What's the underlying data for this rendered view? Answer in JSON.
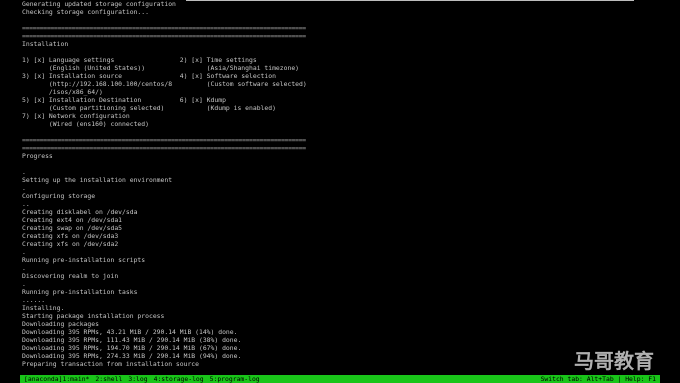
{
  "console": {
    "lines": [
      "Generating updated storage configuration",
      "Checking storage configuration...",
      "",
      "================================================================================",
      "================================================================================",
      "Installation",
      "",
      "1) [x] Language settings                 2) [x] Time settings",
      "       (English (United States))                (Asia/Shanghai timezone)",
      "3) [x] Installation source               4) [x] Software selection",
      "       (http://192.168.100.100/centos/8         (Custom software selected)",
      "       /isos/x86_64/)",
      "5) [x] Installation Destination          6) [x] Kdump",
      "       (Custom partitioning selected)           (Kdump is enabled)",
      "7) [x] Network configuration",
      "       (Wired (ens160) connected)",
      "",
      "================================================================================",
      "================================================================================",
      "Progress",
      "",
      ".",
      "Setting up the installation environment",
      ".",
      "Configuring storage",
      "..",
      "Creating disklabel on /dev/sda",
      "Creating ext4 on /dev/sda1",
      "Creating swap on /dev/sda5",
      "Creating xfs on /dev/sda3",
      "Creating xfs on /dev/sda2",
      ".",
      "Running pre-installation scripts",
      ".",
      "Discovering realm to join",
      ".",
      "Running pre-installation tasks",
      "......",
      "Installing.",
      "Starting package installation process",
      "Downloading packages",
      "Downloading 395 RPMs, 43.21 MiB / 290.14 MiB (14%) done.",
      "Downloading 395 RPMs, 111.43 MiB / 290.14 MiB (38%) done.",
      "Downloading 395 RPMs, 194.70 MiB / 290.14 MiB (67%) done.",
      "Downloading 395 RPMs, 274.33 MiB / 290.14 MiB (94%) done.",
      "Preparing transaction from installation source"
    ]
  },
  "statusbar": {
    "tabs": [
      "[anaconda]1:main*",
      "2:shell",
      "3:log",
      "4:storage-log",
      "5:program-log"
    ],
    "hint": "Switch tab: Alt+Tab | Help: F1"
  },
  "watermark": {
    "text": "马哥教育"
  },
  "colors": {
    "status_green": "#19c519",
    "text_gray": "#c8c8c8"
  }
}
